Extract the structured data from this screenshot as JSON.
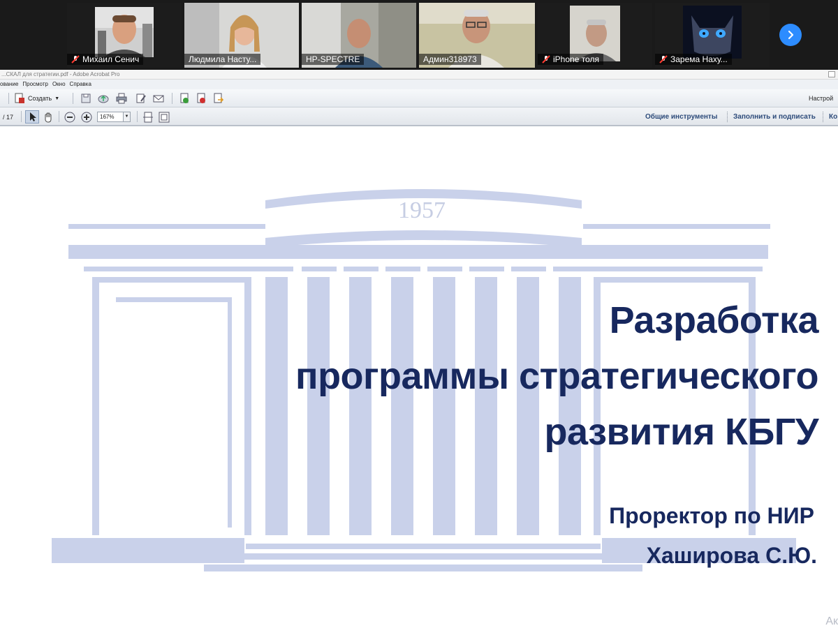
{
  "video_strip": {
    "participants": [
      {
        "name": "Михаил Сенич",
        "muted": true
      },
      {
        "name": "Людмила Насту...",
        "muted": false
      },
      {
        "name": "HP-SPECTRE",
        "muted": false
      },
      {
        "name": "Админ318973",
        "muted": false,
        "speaking": true
      },
      {
        "name": "iPhone толя",
        "muted": true
      },
      {
        "name": "Зарема Наху...",
        "muted": true
      }
    ],
    "next_icon": "chevron-right-icon"
  },
  "acrobat": {
    "window_title": "...СКАЛ для стратегии.pdf - Adobe Acrobat Pro",
    "menu": [
      "ование",
      "Просмотр",
      "Окно",
      "Справка"
    ],
    "toolbar": {
      "create_label": "Создать",
      "customize_label": "Настрой"
    },
    "navigation": {
      "page_total": "/ 17",
      "zoom": "167%"
    },
    "panes": {
      "tools": "Общие инструменты",
      "fill_sign": "Заполнить и подписать",
      "comment": "Ко"
    }
  },
  "slide": {
    "year": "1957",
    "title_lines": [
      "Разработка",
      "программы стратегического",
      "развития КБГУ"
    ],
    "author_role": "Проректор по НИР",
    "author_name": "Хаширова С.Ю."
  },
  "watermark": "Ак"
}
